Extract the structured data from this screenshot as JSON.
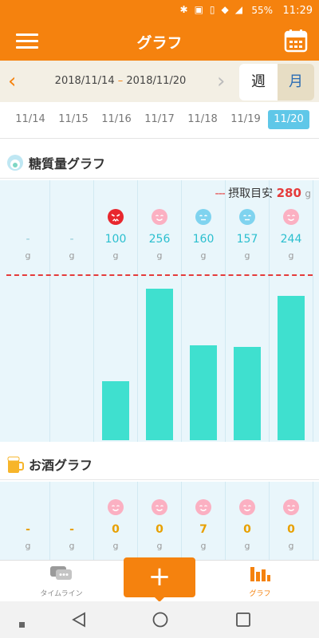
{
  "status_bar": {
    "battery": "55%",
    "time": "11:29"
  },
  "app_bar": {
    "title": "グラフ"
  },
  "date_nav": {
    "start": "2018/11/14",
    "separator": "–",
    "end": "2018/11/20",
    "tab_week": "週",
    "tab_month": "月",
    "prev_glyph": "‹",
    "next_glyph": "›"
  },
  "days": [
    "11/14",
    "11/15",
    "11/16",
    "11/17",
    "11/18",
    "11/19",
    "11/20"
  ],
  "selected_day": "11/20",
  "carb_section": {
    "title": "糖質量グラフ",
    "target_label": "摂取目安",
    "target_value": "280",
    "target_unit": "g",
    "target_dashes": "---",
    "unit": "g"
  },
  "alcohol_section": {
    "title": "お酒グラフ",
    "unit": "g"
  },
  "chart_data": [
    {
      "type": "bar",
      "title": "糖質量グラフ",
      "categories": [
        "11/14",
        "11/15",
        "11/16",
        "11/17",
        "11/18",
        "11/19",
        "11/20"
      ],
      "values": [
        null,
        null,
        100,
        256,
        160,
        157,
        244
      ],
      "labels": [
        "-",
        "-",
        "100",
        "256",
        "160",
        "157",
        "244"
      ],
      "faces": [
        null,
        null,
        "angry-red",
        "happy-pink",
        "neutral-blue",
        "neutral-blue",
        "happy-pink"
      ],
      "reference_line": {
        "label": "摂取目安",
        "value": 280,
        "color": "#e53b3b"
      },
      "unit": "g",
      "ylim": [
        0,
        350
      ],
      "bar_color": "#3fe0cf"
    },
    {
      "type": "bar",
      "title": "お酒グラフ",
      "categories": [
        "11/14",
        "11/15",
        "11/16",
        "11/17",
        "11/18",
        "11/19",
        "11/20"
      ],
      "labels": [
        "-",
        "-",
        "0",
        "0",
        "7",
        "0",
        "0"
      ],
      "faces": [
        null,
        null,
        "happy-pink",
        "happy-pink",
        "happy-pink",
        "happy-pink",
        "happy-pink"
      ],
      "unit": "g"
    }
  ],
  "bottom_nav": {
    "timeline_label": "タイムライン",
    "add_label": "+",
    "graph_label": "グラフ"
  },
  "colors": {
    "accent": "#f5820e",
    "bar": "#3fe0cf",
    "target": "#e53b3b",
    "carb_value": "#2bbfcf",
    "alcohol_value": "#e8a000",
    "selected_day": "#5fc7e8"
  }
}
